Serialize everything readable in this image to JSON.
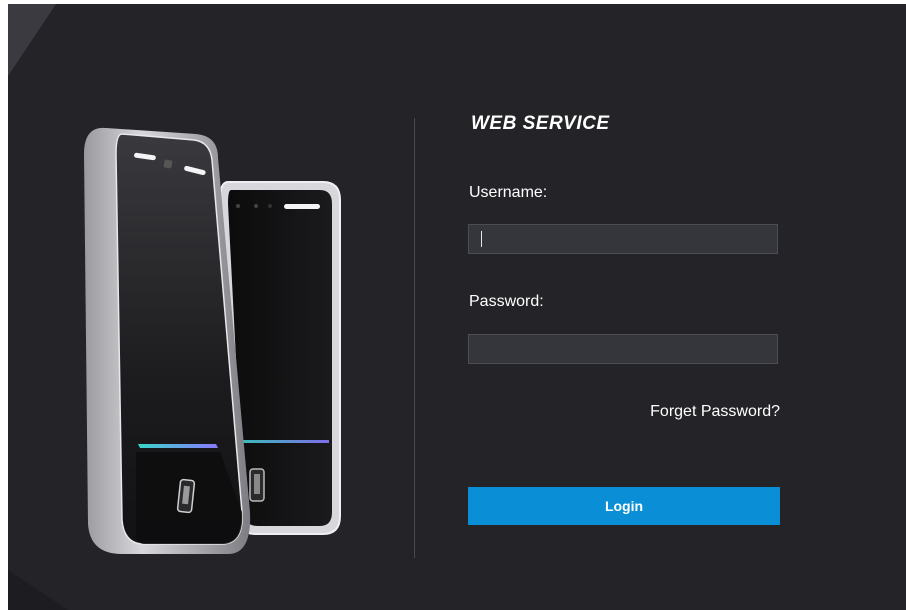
{
  "brand": {
    "title": "WEB SERVICE"
  },
  "form": {
    "username_label": "Username:",
    "username_value": "",
    "password_label": "Password:",
    "password_value": "",
    "forget_password": "Forget Password?",
    "login_label": "Login"
  },
  "colors": {
    "background": "#242428",
    "input_bg": "#35353c",
    "accent": "#0a8fd6",
    "text": "#ffffff"
  },
  "icons": [
    "access-control-device-illustration",
    "fingerprint-sensor-icon"
  ]
}
